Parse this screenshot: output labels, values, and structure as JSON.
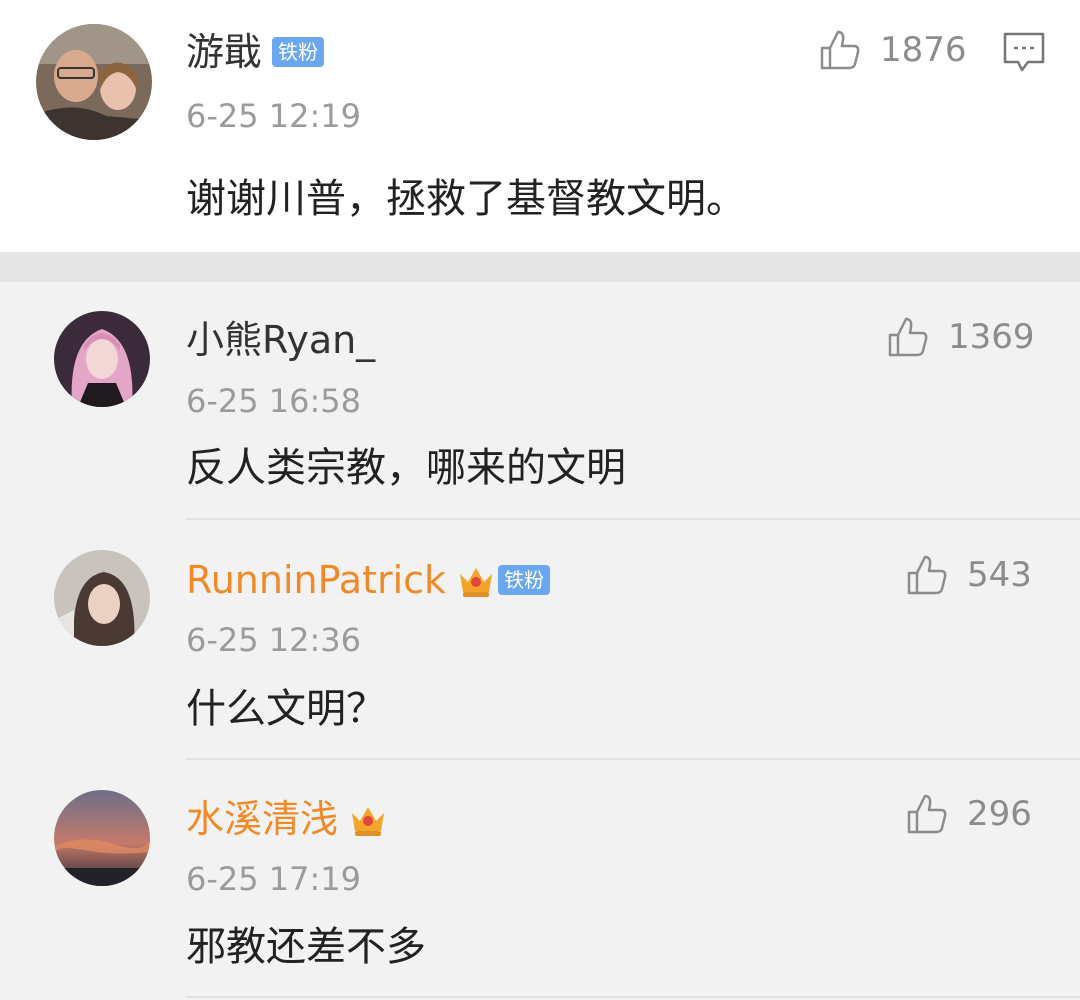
{
  "main_comment": {
    "username": "游戢",
    "badge": "铁粉",
    "time": "6-25 12:19",
    "text": "谢谢川普，拯救了基督教文明。",
    "likes": "1876",
    "icons": [
      "thumbs-up-icon",
      "comment-icon"
    ]
  },
  "replies": [
    {
      "username": "小熊Ryan_",
      "time": "6-25 16:58",
      "text": "反人类宗教，哪来的文明",
      "likes": "1369"
    },
    {
      "username": "RunninPatrick",
      "badge": "铁粉",
      "time": "6-25 12:36",
      "text": "什么文明？",
      "likes": "543"
    },
    {
      "username": "水溪清浅",
      "time": "6-25 17:19",
      "text": "邪教还差不多",
      "likes": "296"
    }
  ],
  "colors": {
    "vip_name": "#f08a28",
    "fan_badge": "#6aa7ef",
    "crown": "#f3a52b"
  }
}
